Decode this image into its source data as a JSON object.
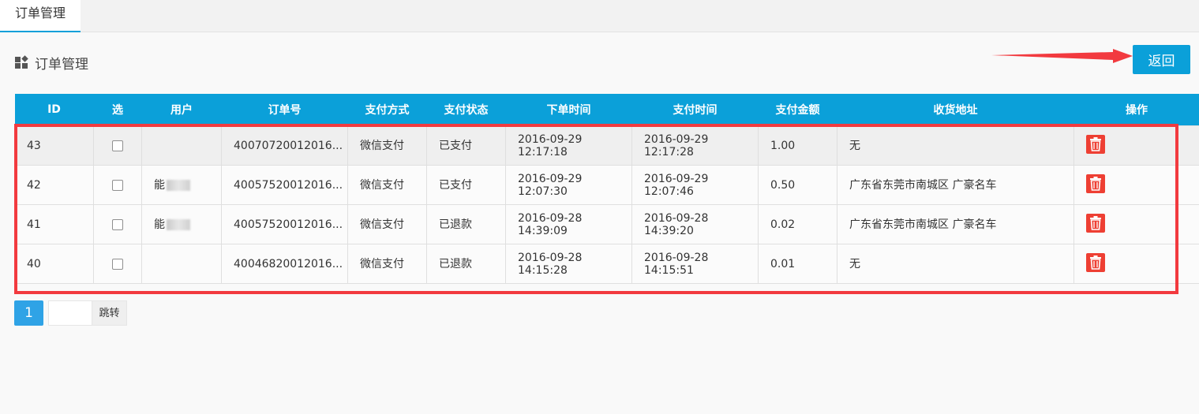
{
  "tab": {
    "label": "订单管理"
  },
  "header": {
    "title": "订单管理",
    "back_label": "返回"
  },
  "table": {
    "columns": [
      "ID",
      "选",
      "用户",
      "订单号",
      "支付方式",
      "支付状态",
      "下单时间",
      "支付时间",
      "支付金额",
      "收货地址",
      "操作"
    ],
    "rows": [
      {
        "id": "43",
        "user": "",
        "order_no": "40070720012016...",
        "pay_method": "微信支付",
        "pay_status": "已支付",
        "order_date": "2016-09-29",
        "order_time": "12:17:18",
        "pay_date": "2016-09-29",
        "pay_time": "12:17:28",
        "amount": "1.00",
        "address": "无"
      },
      {
        "id": "42",
        "user": "能",
        "order_no": "40057520012016...",
        "pay_method": "微信支付",
        "pay_status": "已支付",
        "order_date": "2016-09-29",
        "order_time": "12:07:30",
        "pay_date": "2016-09-29",
        "pay_time": "12:07:46",
        "amount": "0.50",
        "address": "广东省东莞市南城区 广豪名车"
      },
      {
        "id": "41",
        "user": "能",
        "order_no": "40057520012016...",
        "pay_method": "微信支付",
        "pay_status": "已退款",
        "order_date": "2016-09-28",
        "order_time": "14:39:09",
        "pay_date": "2016-09-28",
        "pay_time": "14:39:20",
        "amount": "0.02",
        "address": "广东省东莞市南城区 广豪名车"
      },
      {
        "id": "40",
        "user": "",
        "order_no": "40046820012016...",
        "pay_method": "微信支付",
        "pay_status": "已退款",
        "order_date": "2016-09-28",
        "order_time": "14:15:28",
        "pay_date": "2016-09-28",
        "pay_time": "14:15:51",
        "amount": "0.01",
        "address": "无"
      }
    ]
  },
  "pager": {
    "current": "1",
    "jump_label": "跳转"
  },
  "colors": {
    "primary": "#0ba0d9",
    "delete": "#ee3f33",
    "highlight_border": "#f23a3f",
    "annotation_arrow": "#f23a3f"
  },
  "icons": {
    "title": "dashboard-grid-icon",
    "delete": "trash-icon",
    "arrow": "annotation-arrow-icon"
  }
}
